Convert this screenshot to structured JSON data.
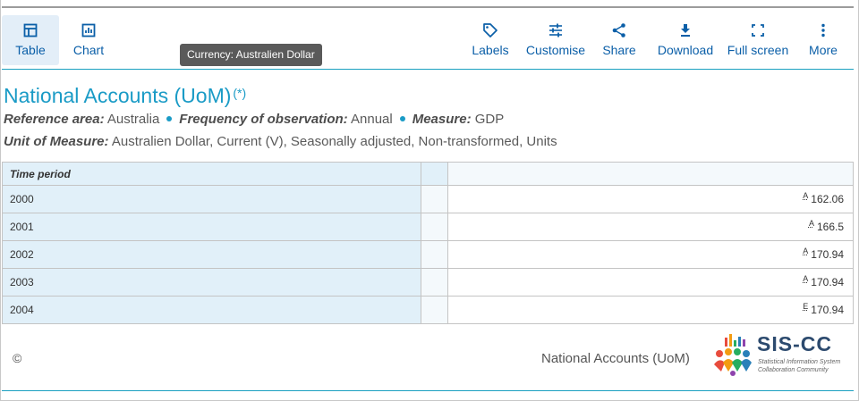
{
  "toolbar": {
    "table": "Table",
    "chart": "Chart",
    "labels": "Labels",
    "customise": "Customise",
    "share": "Share",
    "download": "Download",
    "fullscreen": "Full screen",
    "more": "More"
  },
  "tooltip": "Currency: Australien Dollar",
  "header": {
    "title": "National Accounts (UoM)",
    "asterisk": "(*)",
    "reference_area_label": "Reference area:",
    "reference_area": "Australia",
    "frequency_label": "Frequency of observation:",
    "frequency": "Annual",
    "measure_label": "Measure:",
    "measure": "GDP",
    "unit_label": "Unit of Measure:",
    "unit": "Australien Dollar, Current (V), Seasonally adjusted, Non-transformed, Units"
  },
  "table": {
    "header": "Time period",
    "rows": [
      {
        "period": "2000",
        "flag": "A",
        "value": "162.06"
      },
      {
        "period": "2001",
        "flag": "A",
        "value": "166.5"
      },
      {
        "period": "2002",
        "flag": "A",
        "value": "170.94"
      },
      {
        "period": "2003",
        "flag": "A",
        "value": "170.94"
      },
      {
        "period": "2004",
        "flag": "E",
        "value": "170.94"
      }
    ]
  },
  "footer": {
    "copyright": "©",
    "title": "National Accounts (UoM)",
    "logo_text": "SIS-CC",
    "logo_sub1": "Statistical Information System",
    "logo_sub2": "Collaboration Community"
  },
  "colors": {
    "accent": "#1a9bc6",
    "toolbar_text": "#0b5fa8",
    "period_bg": "#e1f0f9"
  }
}
